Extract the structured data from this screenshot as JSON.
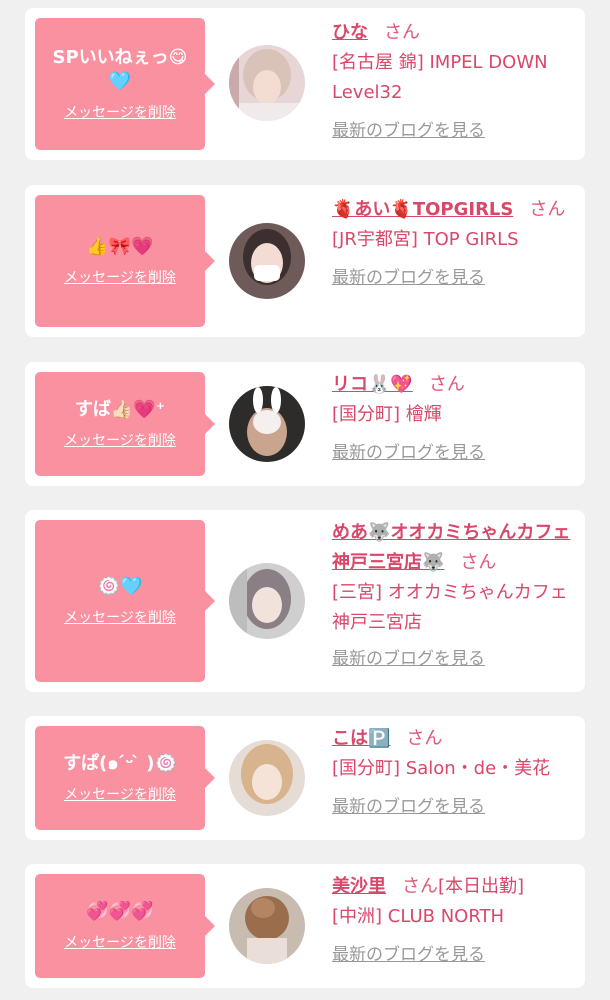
{
  "colors": {
    "background": "#f0f0f0",
    "card": "#ffffff",
    "bubble": "#f991a1",
    "accent": "#d9476a",
    "link_gray": "#999999"
  },
  "common": {
    "delete_label": "メッセージを削除",
    "blog_label": "最新のブログを見る",
    "honorific": "さん"
  },
  "entries": [
    {
      "message": "SPいいねぇっ😋🩵",
      "name": "ひな",
      "shop": "[名古屋 錦] IMPEL DOWN Level32",
      "avatar": "woman-selfie-avatar"
    },
    {
      "message": "👍🎀💗",
      "name": "🫀あい🫀TOPGIRLS",
      "shop": "[JR宇都宮] TOP GIRLS",
      "avatar": "masked-woman-avatar"
    },
    {
      "message": "すば👍🏻💗⁺",
      "name": "リコ🐰💖",
      "shop": "[国分町] 檜輝",
      "avatar": "bunny-filter-avatar"
    },
    {
      "message": "🍥🩵",
      "name": "めあ🐺オオカミちゃんカフェ神戸三宮店🐺",
      "shop": "[三宮] オオカミちゃんカフェ神戸三宮店",
      "avatar": "woman-peace-sign-avatar"
    },
    {
      "message": "すぱ(๑ ́ᵕ ̀ )🍥",
      "name": "こは🅿️",
      "shop": "[国分町] Salon・de・美花",
      "avatar": "blonde-woman-avatar"
    },
    {
      "message": "💞💞💞",
      "name": "美沙里",
      "status": "[本日出勤]",
      "shop": "[中洲] CLUB NORTH",
      "avatar": "updo-hair-avatar"
    }
  ]
}
